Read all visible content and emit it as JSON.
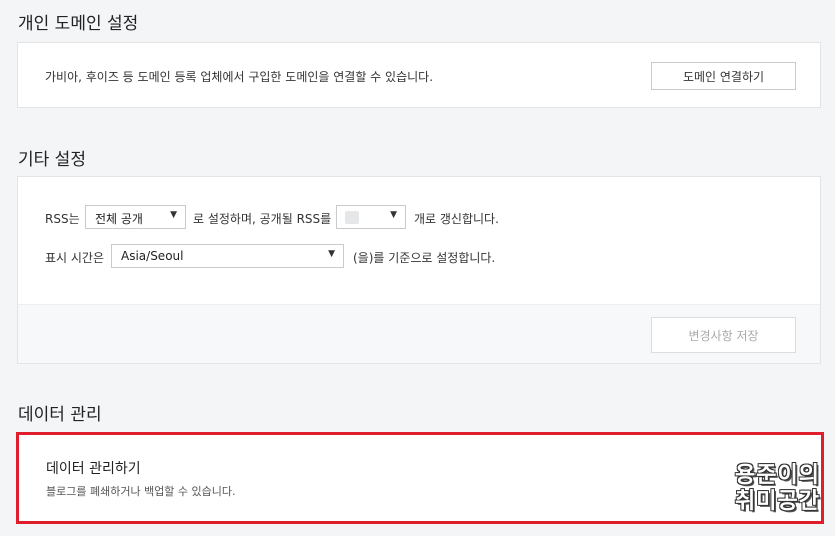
{
  "domain_section": {
    "title": "개인 도메인 설정",
    "description": "가비아, 후이즈 등 도메인 등록 업체에서 구입한 도메인을 연결할 수 있습니다.",
    "connect_button": "도메인 연결하기"
  },
  "other_section": {
    "title": "기타 설정",
    "rss": {
      "prefix": "RSS는",
      "visibility_value": "전체 공개",
      "middle": "로 설정하며, 공개될 RSS를",
      "suffix": "개로 갱신합니다."
    },
    "timezone": {
      "prefix": "표시 시간은",
      "value": "Asia/Seoul",
      "suffix": "(을)를 기준으로 설정합니다."
    },
    "save_button": "변경사항 저장"
  },
  "data_section": {
    "title": "데이터 관리",
    "item_title": "데이터 관리하기",
    "item_description": "블로그를 폐쇄하거나 백업할 수 있습니다."
  },
  "watermark": {
    "line1": "용준이의",
    "line2": "취미공간"
  },
  "colors": {
    "highlight": "#e01e2b",
    "background": "#f4f5f7"
  }
}
